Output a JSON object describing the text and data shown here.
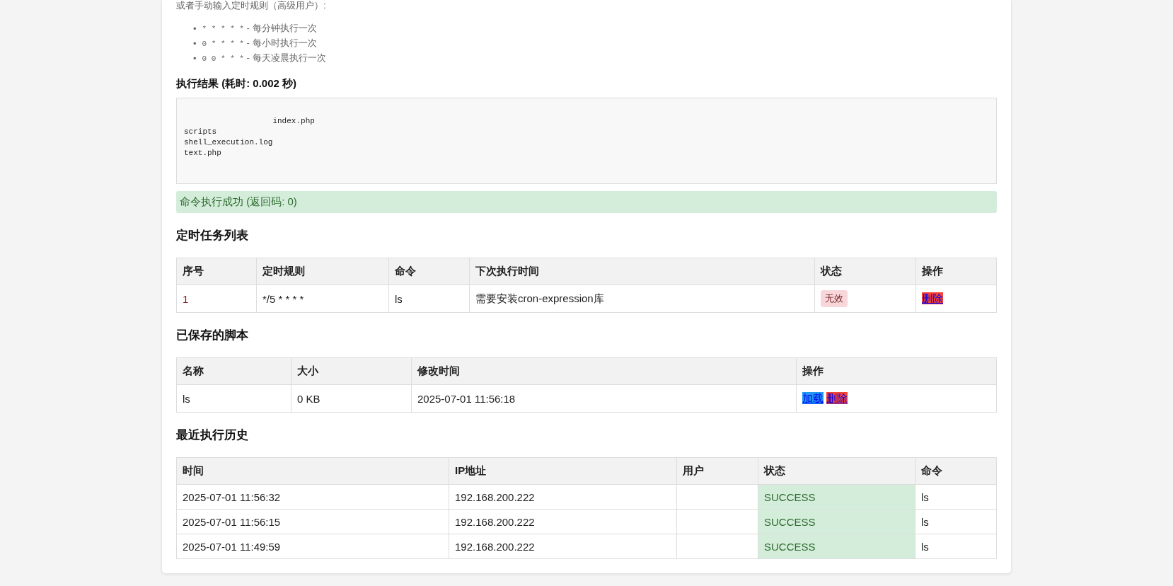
{
  "intro": "或者手动输入定时规则（高级用户）:",
  "cron_examples": [
    {
      "bullet": "•",
      "expr": "* * * * *",
      "desc": "- 每分钟执行一次"
    },
    {
      "bullet": "•",
      "expr": "0 * * * *",
      "desc": "- 每小时执行一次"
    },
    {
      "bullet": "•",
      "expr": "0 0 * * *",
      "desc": "- 每天凌晨执行一次"
    }
  ],
  "result": {
    "heading": "执行结果 (耗时: 0.002 秒)",
    "output": "\n                   index.php\nscripts\nshell_execution.log\ntext.php\n\n",
    "message": "命令执行成功 (返回码: 0)",
    "success": true
  },
  "tasks": {
    "heading": "定时任务列表",
    "columns": [
      "序号",
      "定时规则",
      "命令",
      "下次执行时间",
      "状态",
      "操作"
    ],
    "rows": [
      {
        "index": "1",
        "rule": "*/5 * * * *",
        "command": "ls",
        "next_run": "需要安装cron-expression库",
        "status": {
          "text": "无效",
          "kind": "invalid"
        },
        "actions": [
          {
            "label": "删除",
            "kind": "delete"
          }
        ]
      }
    ]
  },
  "scripts": {
    "heading": "已保存的脚本",
    "columns": [
      "名称",
      "大小",
      "修改时间",
      "操作"
    ],
    "rows": [
      {
        "name": "ls",
        "size": "0 KB",
        "modified": "2025-07-01 11:56:18",
        "actions": [
          {
            "label": "加载",
            "kind": "load"
          },
          {
            "label": "删除",
            "kind": "delete"
          }
        ]
      }
    ]
  },
  "history": {
    "heading": "最近执行历史",
    "columns": [
      "时间",
      "IP地址",
      "用户",
      "状态",
      "命令"
    ],
    "rows": [
      {
        "time": "2025-07-01 11:56:32",
        "ip": "192.168.200.222",
        "status": {
          "text": "SUCCESS",
          "kind": "success"
        },
        "command": "ls"
      },
      {
        "time": "2025-07-01 11:56:15",
        "ip": "192.168.200.222",
        "status": {
          "text": "SUCCESS",
          "kind": "success"
        },
        "command": "ls"
      },
      {
        "time": "2025-07-01 11:49:59",
        "ip": "192.168.200.222",
        "status": {
          "text": "SUCCESS",
          "kind": "success"
        },
        "command": "ls"
      }
    ]
  }
}
